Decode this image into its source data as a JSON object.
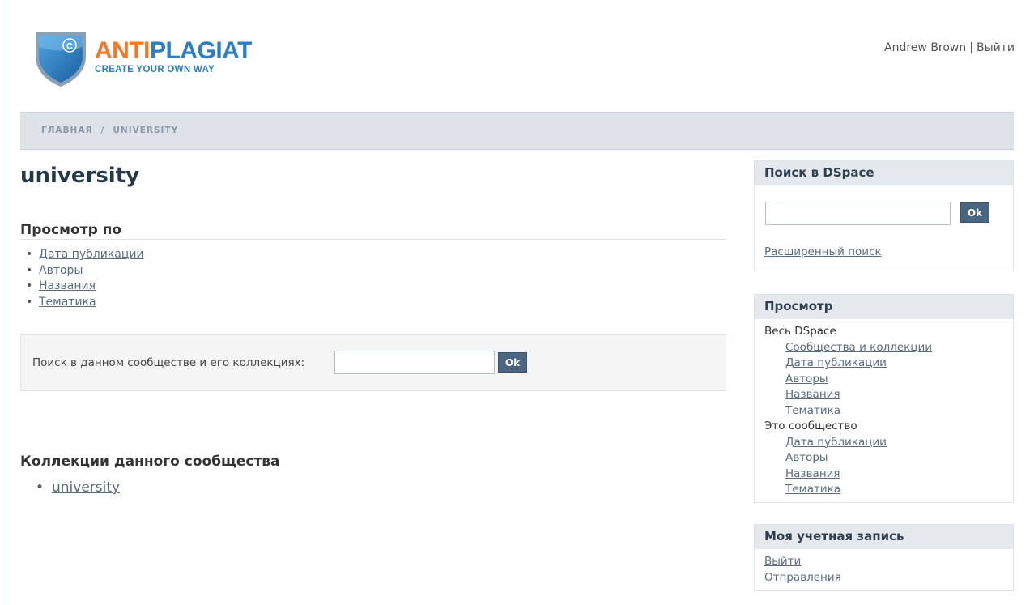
{
  "brand": {
    "name_part1": "ANTI",
    "name_part2": "PLAGIAT",
    "tagline": "CREATE YOUR OWN WAY",
    "shield_symbol": "©",
    "colors": {
      "orange": "#f0782a",
      "blue": "#2d7fc1"
    }
  },
  "user": {
    "name": "Andrew Brown",
    "separator": "|",
    "logout": "Выйти"
  },
  "breadcrumb": {
    "home": "ГЛАВНАЯ",
    "separator": "/",
    "current": "UNIVERSITY"
  },
  "main": {
    "title": "university",
    "browse_heading": "Просмотр по",
    "browse_items": [
      "Дата публикации",
      "Авторы",
      "Названия",
      "Тематика"
    ],
    "search_label": "Поиск в данном сообществе и его коллекциях:",
    "search_value": "",
    "search_button": "Ok",
    "collections_heading": "Коллекции данного сообщества",
    "collections": [
      "university"
    ]
  },
  "sidebar": {
    "search": {
      "heading": "Поиск в DSpace",
      "value": "",
      "button": "Ok",
      "advanced": "Расширенный поиск"
    },
    "browse": {
      "heading": "Просмотр",
      "all_label": "Весь DSpace",
      "all_items": [
        "Сообщества и коллекции",
        "Дата публикации",
        "Авторы",
        "Названия",
        "Тематика"
      ],
      "community_label": "Это сообщество",
      "community_items": [
        "Дата публикации",
        "Авторы",
        "Названия",
        "Тематика"
      ]
    },
    "account": {
      "heading": "Моя учетная запись",
      "items": [
        "Выйти",
        "Отправления"
      ]
    }
  }
}
